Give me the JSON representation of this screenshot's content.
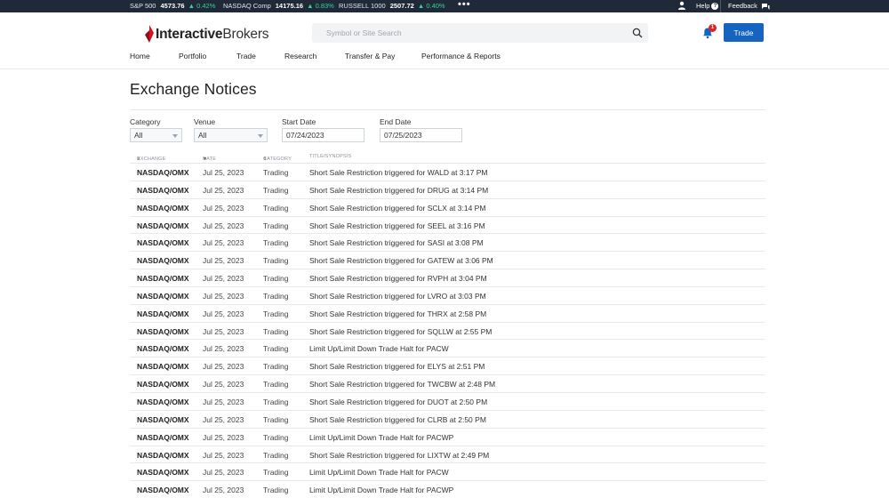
{
  "ticker": [
    {
      "name": "S&P 500",
      "value": "4573.76",
      "change": "▲ 0.42%"
    },
    {
      "name": "NASDAQ Comp",
      "value": "14175.16",
      "change": "▲ 0.83%"
    },
    {
      "name": "RUSSELL 1000",
      "value": "2507.72",
      "change": "▲ 0.40%"
    }
  ],
  "ticker_more": "•••",
  "topbar": {
    "help_label": "Help",
    "feedback_label": "Feedback"
  },
  "logo": {
    "bold": "Interactive",
    "light": "Brokers"
  },
  "search": {
    "placeholder": "Symbol or Site Search"
  },
  "notifications": {
    "count": "1"
  },
  "trade_button": "Trade",
  "nav": [
    "Home",
    "Portfolio",
    "Trade",
    "Research",
    "Transfer & Pay",
    "Performance & Reports"
  ],
  "page_title": "Exchange Notices",
  "filters": {
    "category_label": "Category",
    "category_value": "All",
    "venue_label": "Venue",
    "venue_value": "All",
    "start_label": "Start Date",
    "start_value": "07/24/2023",
    "end_label": "End Date",
    "end_value": "07/25/2023"
  },
  "table": {
    "headers": {
      "exchange": "EXCHANGE",
      "date": "DATE",
      "category": "CATEGORY",
      "title": "TITLE/SYNOPSIS"
    },
    "rows": [
      {
        "exchange": "NASDAQ/OMX",
        "date": "Jul 25, 2023",
        "category": "Trading",
        "title": "Short Sale Restriction triggered for WALD at 3:17 PM"
      },
      {
        "exchange": "NASDAQ/OMX",
        "date": "Jul 25, 2023",
        "category": "Trading",
        "title": "Short Sale Restriction triggered for DRUG at 3:14 PM"
      },
      {
        "exchange": "NASDAQ/OMX",
        "date": "Jul 25, 2023",
        "category": "Trading",
        "title": "Short Sale Restriction triggered for SCLX at 3:14 PM"
      },
      {
        "exchange": "NASDAQ/OMX",
        "date": "Jul 25, 2023",
        "category": "Trading",
        "title": "Short Sale Restriction triggered for SEEL at 3:16 PM"
      },
      {
        "exchange": "NASDAQ/OMX",
        "date": "Jul 25, 2023",
        "category": "Trading",
        "title": "Short Sale Restriction triggered for SASI at 3:08 PM"
      },
      {
        "exchange": "NASDAQ/OMX",
        "date": "Jul 25, 2023",
        "category": "Trading",
        "title": "Short Sale Restriction triggered for GATEW at 3:06 PM"
      },
      {
        "exchange": "NASDAQ/OMX",
        "date": "Jul 25, 2023",
        "category": "Trading",
        "title": "Short Sale Restriction triggered for RVPH at 3:04 PM"
      },
      {
        "exchange": "NASDAQ/OMX",
        "date": "Jul 25, 2023",
        "category": "Trading",
        "title": "Short Sale Restriction triggered for LVRO at 3:03 PM"
      },
      {
        "exchange": "NASDAQ/OMX",
        "date": "Jul 25, 2023",
        "category": "Trading",
        "title": "Short Sale Restriction triggered for THRX at 2:58 PM"
      },
      {
        "exchange": "NASDAQ/OMX",
        "date": "Jul 25, 2023",
        "category": "Trading",
        "title": "Short Sale Restriction triggered for SQLLW at 2:55 PM"
      },
      {
        "exchange": "NASDAQ/OMX",
        "date": "Jul 25, 2023",
        "category": "Trading",
        "title": "Limit Up/Limit Down Trade Halt for PACW"
      },
      {
        "exchange": "NASDAQ/OMX",
        "date": "Jul 25, 2023",
        "category": "Trading",
        "title": "Short Sale Restriction triggered for ELYS at 2:51 PM"
      },
      {
        "exchange": "NASDAQ/OMX",
        "date": "Jul 25, 2023",
        "category": "Trading",
        "title": "Short Sale Restriction triggered for TWCBW at 2:48 PM"
      },
      {
        "exchange": "NASDAQ/OMX",
        "date": "Jul 25, 2023",
        "category": "Trading",
        "title": "Short Sale Restriction triggered for DUOT at 2:50 PM"
      },
      {
        "exchange": "NASDAQ/OMX",
        "date": "Jul 25, 2023",
        "category": "Trading",
        "title": "Short Sale Restriction triggered for CLRB at 2:50 PM"
      },
      {
        "exchange": "NASDAQ/OMX",
        "date": "Jul 25, 2023",
        "category": "Trading",
        "title": "Limit Up/Limit Down Trade Halt for PACWP"
      },
      {
        "exchange": "NASDAQ/OMX",
        "date": "Jul 25, 2023",
        "category": "Trading",
        "title": "Short Sale Restriction triggered for LIXTW at 2:49 PM"
      },
      {
        "exchange": "NASDAQ/OMX",
        "date": "Jul 25, 2023",
        "category": "Trading",
        "title": "Limit Up/Limit Down Trade Halt for PACW"
      },
      {
        "exchange": "NASDAQ/OMX",
        "date": "Jul 25, 2023",
        "category": "Trading",
        "title": "Limit Up/Limit Down Trade Halt for PACWP"
      }
    ]
  },
  "colors": {
    "ticker_bg": "#1f2937",
    "ticker_up": "#34d399",
    "brand_red": "#d81222",
    "primary_blue": "#1565c0"
  }
}
